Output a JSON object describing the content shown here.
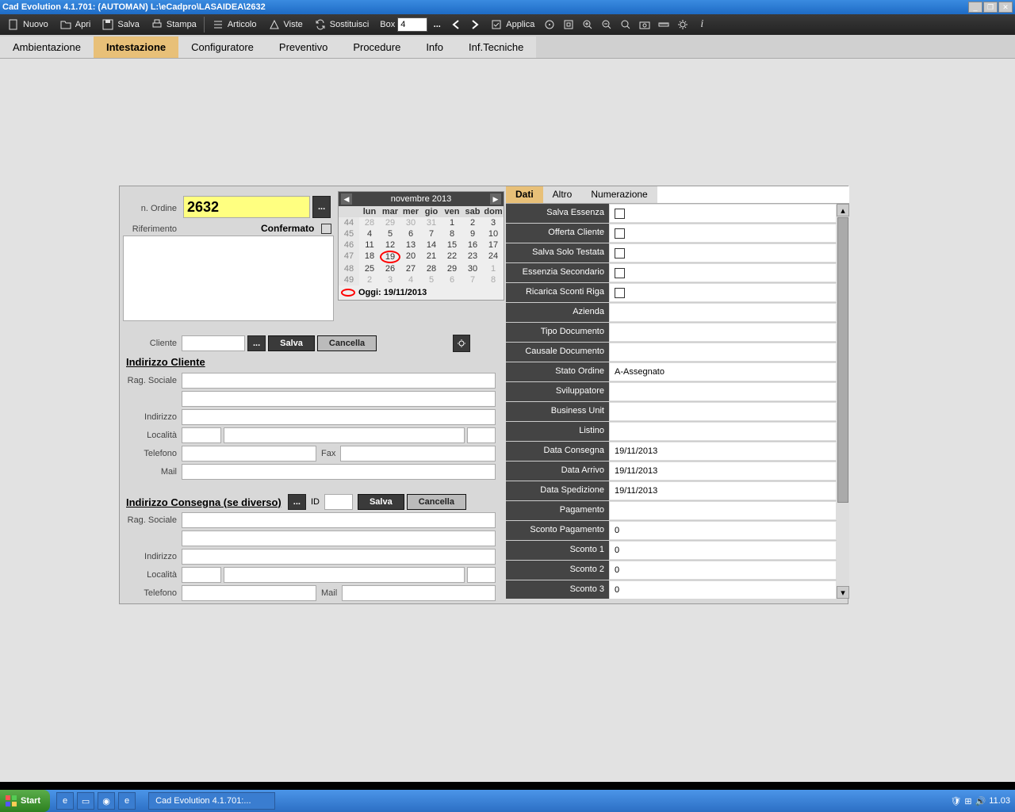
{
  "title": "Cad Evolution 4.1.701: (AUTOMAN)  L:\\eCadpro\\LASAIDEA\\2632",
  "toolbar": {
    "nuovo": "Nuovo",
    "apri": "Apri",
    "salva": "Salva",
    "stampa": "Stampa",
    "articolo": "Articolo",
    "viste": "Viste",
    "sostituisci": "Sostituisci",
    "box": "Box",
    "boxval": "4",
    "applica": "Applica",
    "dots": "..."
  },
  "tabs": [
    "Ambientazione",
    "Intestazione",
    "Configuratore",
    "Preventivo",
    "Procedure",
    "Info",
    "Inf.Tecniche"
  ],
  "active_tab": 1,
  "left": {
    "n_ordine_lbl": "n. Ordine",
    "n_ordine": "2632",
    "riferimento_lbl": "Riferimento",
    "confermato_lbl": "Confermato",
    "cliente_lbl": "Cliente",
    "salva": "Salva",
    "cancella": "Cancella",
    "indcli": "Indirizzo Cliente",
    "ragsoc": "Rag. Sociale",
    "indirizzo": "Indirizzo",
    "localita": "Località",
    "telefono": "Telefono",
    "fax": "Fax",
    "mail": "Mail",
    "indcons": "Indirizzo Consegna (se diverso)",
    "id": "ID"
  },
  "calendar": {
    "month": "novembre 2013",
    "dow": [
      "lun",
      "mar",
      "mer",
      "gio",
      "ven",
      "sab",
      "dom"
    ],
    "weeks": [
      {
        "wk": "44",
        "days": [
          {
            "d": "28",
            "o": true
          },
          {
            "d": "29",
            "o": true
          },
          {
            "d": "30",
            "o": true
          },
          {
            "d": "31",
            "o": true
          },
          {
            "d": "1"
          },
          {
            "d": "2"
          },
          {
            "d": "3"
          }
        ]
      },
      {
        "wk": "45",
        "days": [
          {
            "d": "4"
          },
          {
            "d": "5"
          },
          {
            "d": "6"
          },
          {
            "d": "7"
          },
          {
            "d": "8"
          },
          {
            "d": "9"
          },
          {
            "d": "10"
          }
        ]
      },
      {
        "wk": "46",
        "days": [
          {
            "d": "11"
          },
          {
            "d": "12"
          },
          {
            "d": "13"
          },
          {
            "d": "14"
          },
          {
            "d": "15"
          },
          {
            "d": "16"
          },
          {
            "d": "17"
          }
        ]
      },
      {
        "wk": "47",
        "days": [
          {
            "d": "18"
          },
          {
            "d": "19",
            "t": true
          },
          {
            "d": "20"
          },
          {
            "d": "21"
          },
          {
            "d": "22"
          },
          {
            "d": "23"
          },
          {
            "d": "24"
          }
        ]
      },
      {
        "wk": "48",
        "days": [
          {
            "d": "25"
          },
          {
            "d": "26"
          },
          {
            "d": "27"
          },
          {
            "d": "28"
          },
          {
            "d": "29"
          },
          {
            "d": "30"
          },
          {
            "d": "1",
            "o": true
          }
        ]
      },
      {
        "wk": "49",
        "days": [
          {
            "d": "2",
            "o": true
          },
          {
            "d": "3",
            "o": true
          },
          {
            "d": "4",
            "o": true
          },
          {
            "d": "5",
            "o": true
          },
          {
            "d": "6",
            "o": true
          },
          {
            "d": "7",
            "o": true
          },
          {
            "d": "8",
            "o": true
          }
        ]
      }
    ],
    "today_lbl": "Oggi: 19/11/2013"
  },
  "right": {
    "tabs": [
      "Dati",
      "Altro",
      "Numerazione"
    ],
    "active": 0,
    "props": [
      {
        "l": "Salva Essenza",
        "check": true
      },
      {
        "l": "Offerta Cliente",
        "check": true
      },
      {
        "l": "Salva Solo Testata",
        "check": true
      },
      {
        "l": "Essenzia Secondario",
        "check": true
      },
      {
        "l": "Ricarica Sconti Riga",
        "check": true
      },
      {
        "l": "Azienda",
        "v": ""
      },
      {
        "l": "Tipo Documento",
        "v": ""
      },
      {
        "l": "Causale Documento",
        "v": ""
      },
      {
        "l": "Stato Ordine",
        "v": "A-Assegnato"
      },
      {
        "l": "Sviluppatore",
        "v": ""
      },
      {
        "l": "Business Unit",
        "v": ""
      },
      {
        "l": "Listino",
        "v": ""
      },
      {
        "l": "Data Consegna",
        "v": "19/11/2013"
      },
      {
        "l": "Data Arrivo",
        "v": "19/11/2013"
      },
      {
        "l": "Data Spedizione",
        "v": "19/11/2013"
      },
      {
        "l": "Pagamento",
        "v": ""
      },
      {
        "l": "Sconto Pagamento",
        "v": "0"
      },
      {
        "l": "Sconto 1",
        "v": "0"
      },
      {
        "l": "Sconto 2",
        "v": "0"
      },
      {
        "l": "Sconto 3",
        "v": "0"
      }
    ]
  },
  "taskbar": {
    "start": "Start",
    "app": "Cad Evolution 4.1.701:...",
    "time": "11.03"
  }
}
